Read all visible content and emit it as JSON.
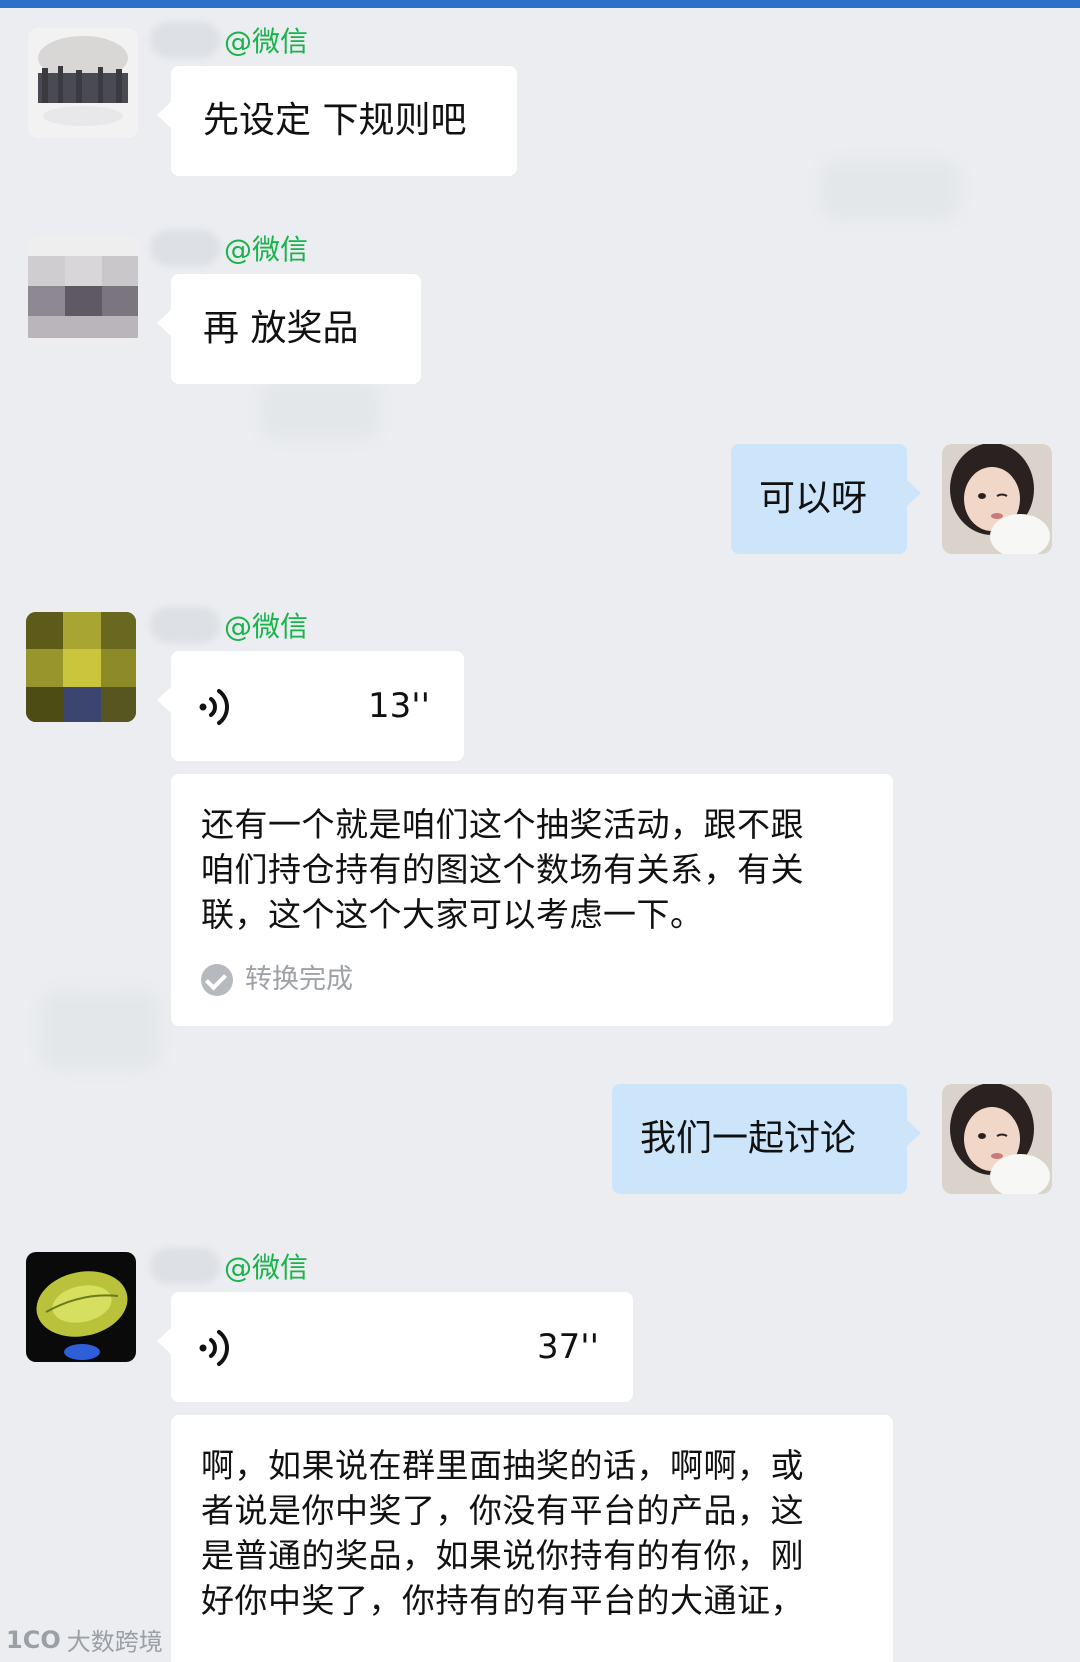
{
  "messages": [
    {
      "side": "left",
      "sender_tag": "@微信",
      "type": "text",
      "text": "先设定 下规则吧"
    },
    {
      "side": "left",
      "sender_tag": "@微信",
      "type": "text",
      "text": "再 放奖品"
    },
    {
      "side": "right",
      "type": "text",
      "text": "可以呀"
    },
    {
      "side": "left",
      "sender_tag": "@微信",
      "type": "voice",
      "duration": "13''",
      "transcript_lines": [
        "还有一个就是咱们这个抽奖活动，跟不跟",
        "咱们持仓持有的图这个数场有关系，有关",
        "联，这个这个大家可以考虑一下。"
      ],
      "status": "转换完成"
    },
    {
      "side": "right",
      "type": "text",
      "text": "我们一起讨论"
    },
    {
      "side": "left",
      "sender_tag": "@微信",
      "type": "voice",
      "duration": "37''",
      "transcript_lines": [
        "啊，如果说在群里面抽奖的话，啊啊，或",
        "者说是你中奖了，你没有平台的产品，这",
        "是普通的奖品，如果说你持有的有你，刚",
        "好你中奖了，你持有的有平台的大通证，"
      ]
    }
  ],
  "watermark": {
    "logo": "1CO",
    "text": "大数跨境"
  },
  "colors": {
    "background": "#ebedf0",
    "sent_bubble": "#cde5fb",
    "sender_tag": "#16b44a",
    "top_bar": "#2b6fc8"
  }
}
